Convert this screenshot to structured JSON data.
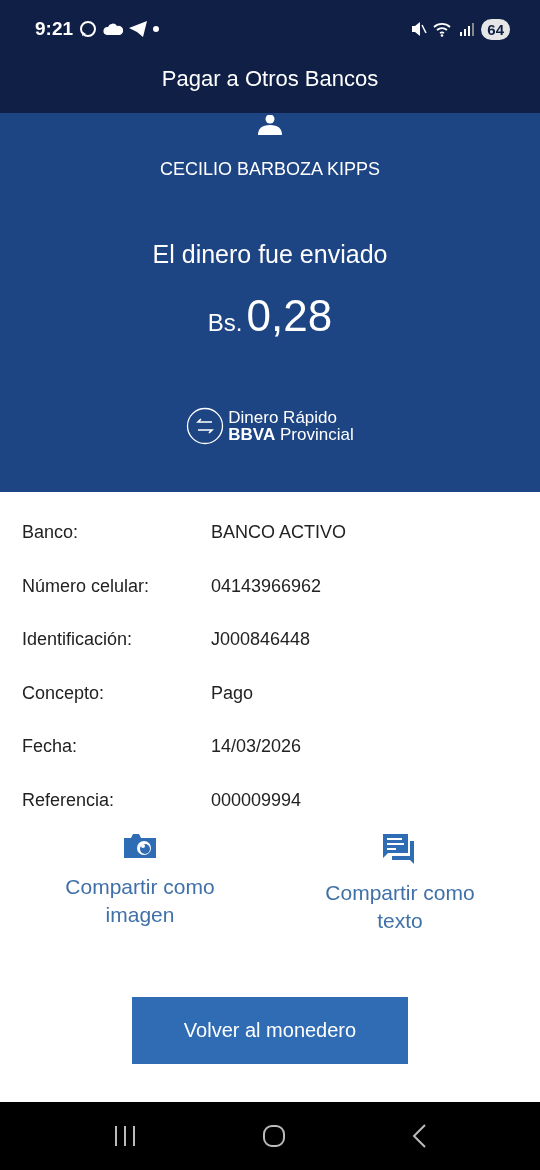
{
  "status_bar": {
    "time": "9:21",
    "battery": "64"
  },
  "header": {
    "title": "Pagar a Otros Bancos"
  },
  "recipient": {
    "name": "CECILIO BARBOZA KIPPS"
  },
  "result": {
    "message": "El dinero fue enviado",
    "currency": "Bs.",
    "amount": "0,28"
  },
  "brand": {
    "line_1": "Dinero Rápido",
    "line_2_bold": "BBVA",
    "line_2": "Provincial"
  },
  "details": [
    {
      "label": "Banco:",
      "value": "BANCO ACTIVO"
    },
    {
      "label": "Número celular:",
      "value": "04143966962"
    },
    {
      "label": "Identificación:",
      "value": "J000846448"
    },
    {
      "label": "Concepto:",
      "value": "Pago"
    },
    {
      "label": "Fecha:",
      "value": "14/03/2026"
    },
    {
      "label": "Referencia:",
      "value": "000009994"
    }
  ],
  "share_options": [
    {
      "kind": "image",
      "label": "Compartir como imagen"
    },
    {
      "kind": "text",
      "label": "Compartir como texto"
    }
  ],
  "primary_button": {
    "label": "Volver al monedero"
  }
}
